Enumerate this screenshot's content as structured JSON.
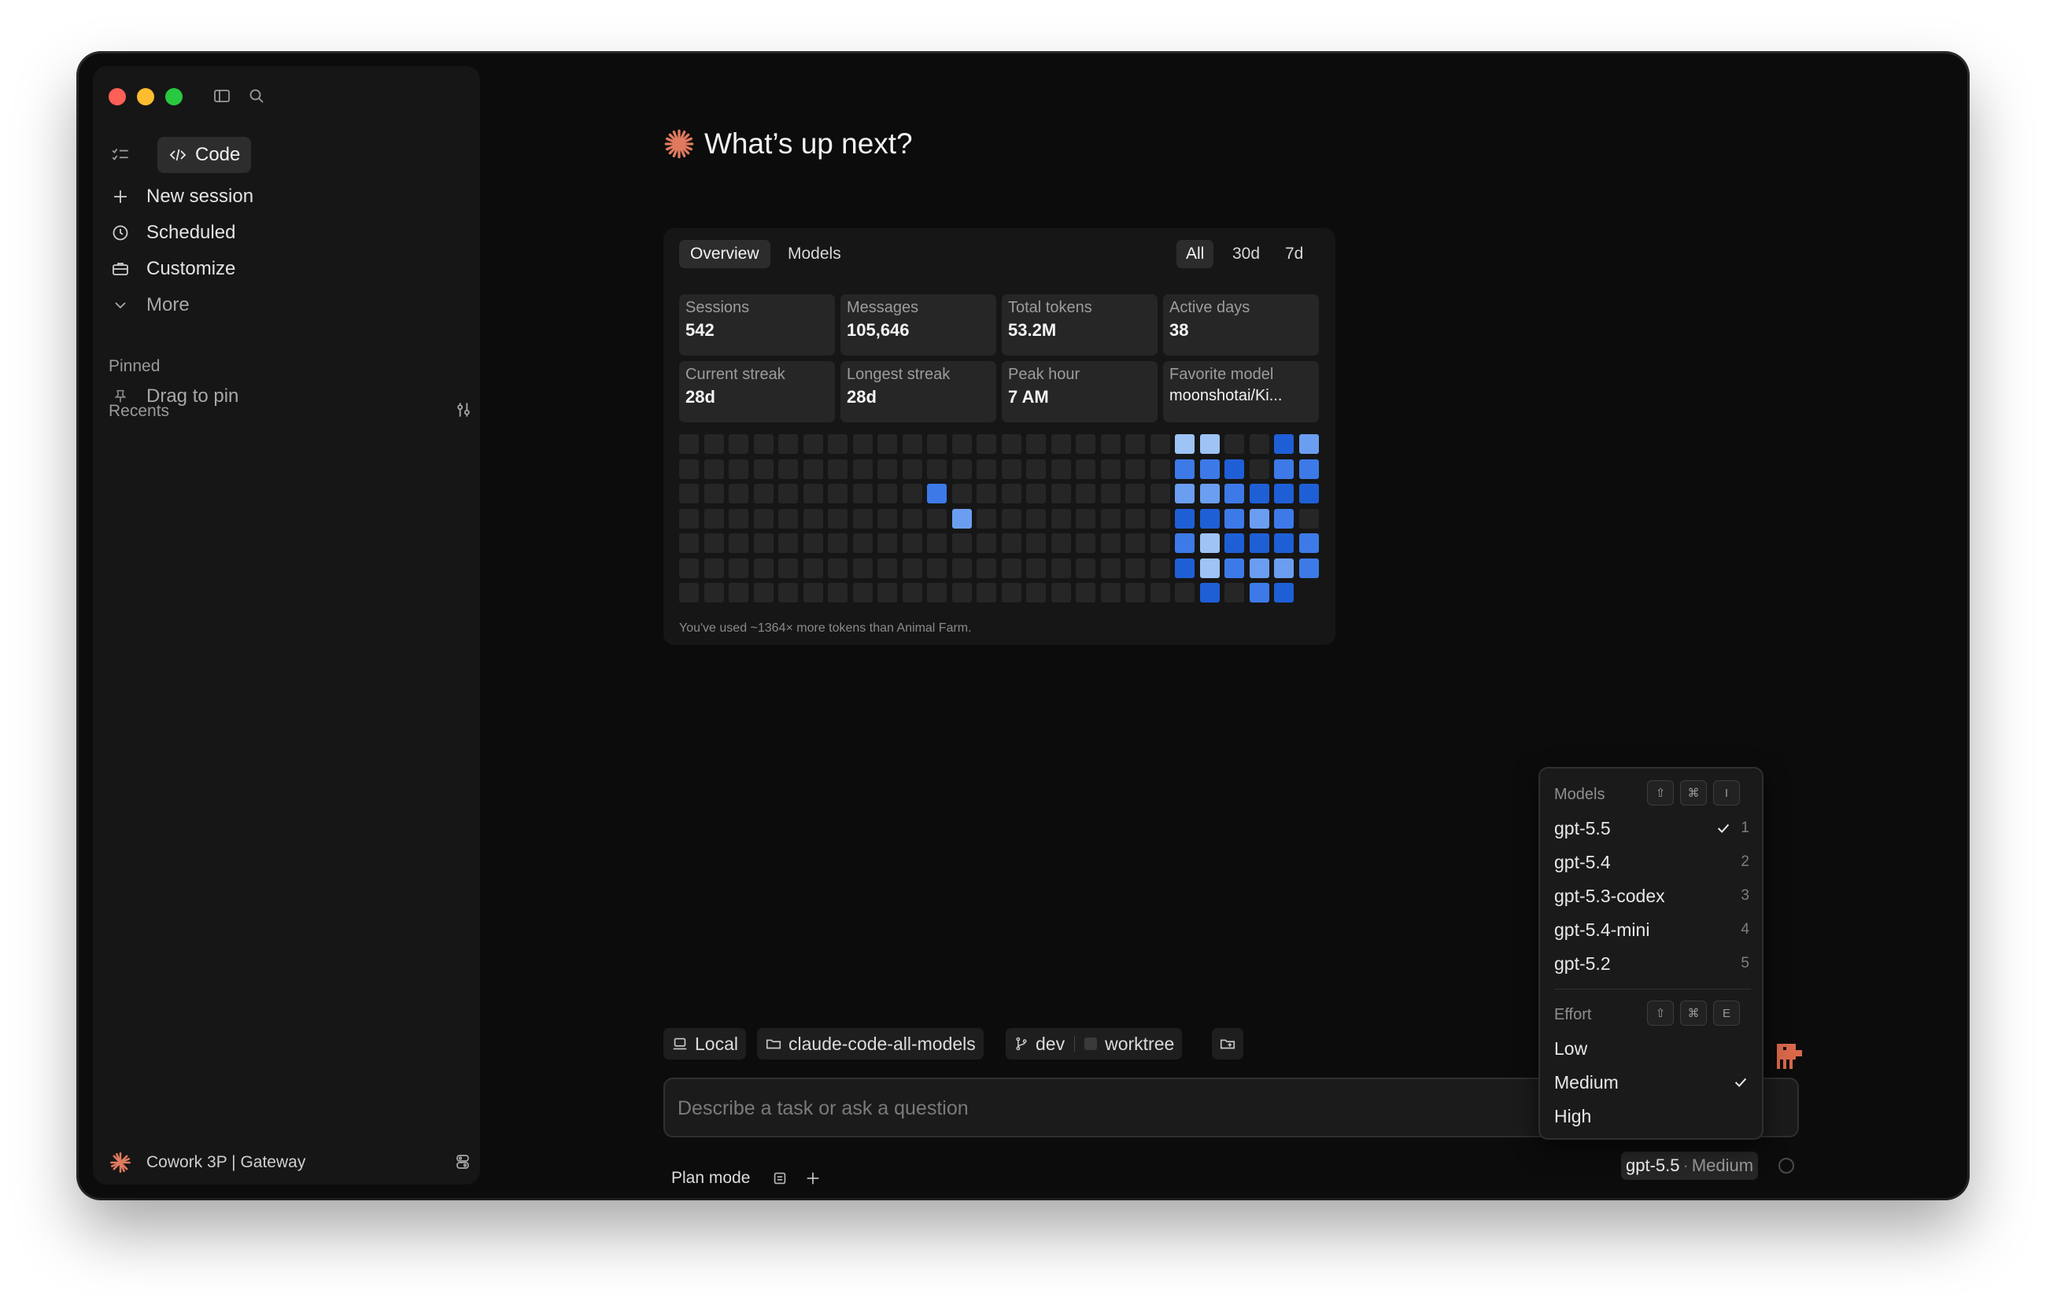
{
  "sidebar": {
    "code_label": "Code",
    "nav": [
      {
        "label": "New session",
        "icon": "plus-icon"
      },
      {
        "label": "Scheduled",
        "icon": "clock-icon"
      },
      {
        "label": "Customize",
        "icon": "briefcase-icon"
      },
      {
        "label": "More",
        "icon": "chevron-down-icon"
      }
    ],
    "pinned_label": "Pinned",
    "drag_to_pin": "Drag to pin",
    "recents_label": "Recents",
    "footer_label": "Cowork 3P | Gateway"
  },
  "main": {
    "headline": "What’s up next?",
    "stats": {
      "tabs": [
        "Overview",
        "Models"
      ],
      "ranges": [
        "All",
        "30d",
        "7d"
      ],
      "cards": [
        {
          "label": "Sessions",
          "value": "542"
        },
        {
          "label": "Messages",
          "value": "105,646"
        },
        {
          "label": "Total tokens",
          "value": "53.2M"
        },
        {
          "label": "Active days",
          "value": "38"
        },
        {
          "label": "Current streak",
          "value": "28d"
        },
        {
          "label": "Longest streak",
          "value": "28d"
        },
        {
          "label": "Peak hour",
          "value": "7 AM"
        },
        {
          "label": "Favorite model",
          "value": "moonshotai/Ki..."
        }
      ],
      "footnote": "You've used ~1364× more tokens than Animal Farm."
    },
    "context_chips": [
      {
        "label": "Local",
        "icon": "laptop-icon"
      },
      {
        "label": "claude-code-all-models",
        "icon": "folder-icon"
      },
      {
        "label": "dev",
        "icon": "git-branch-icon"
      },
      {
        "label": "worktree",
        "icon": "worktree-toggle-icon"
      }
    ],
    "input_placeholder": "Describe a task or ask a question",
    "plan_mode": "Plan mode",
    "model_badge": {
      "model": "gpt-5.5",
      "separator": "·",
      "effort": "Medium"
    }
  },
  "dropdown": {
    "models_header": "Models",
    "models_shortcut": [
      "⇧",
      "⌘",
      "I"
    ],
    "models": [
      {
        "name": "gpt-5.5",
        "num": "1",
        "selected": true
      },
      {
        "name": "gpt-5.4",
        "num": "2",
        "selected": false
      },
      {
        "name": "gpt-5.3-codex",
        "num": "3",
        "selected": false
      },
      {
        "name": "gpt-5.4-mini",
        "num": "4",
        "selected": false
      },
      {
        "name": "gpt-5.2",
        "num": "5",
        "selected": false
      }
    ],
    "effort_header": "Effort",
    "effort_shortcut": [
      "⇧",
      "⌘",
      "E"
    ],
    "efforts": [
      {
        "name": "Low",
        "selected": false
      },
      {
        "name": "Medium",
        "selected": true
      },
      {
        "name": "High",
        "selected": false
      }
    ]
  },
  "heatmap": {
    "columns": 26,
    "rows": 7,
    "colors": {
      "empty": "#262626",
      "level1": "#9ec3f5",
      "level2": "#6b9ef0",
      "level3": "#3d7ae8",
      "level4": "#1f5fd6"
    },
    "active_levels": [
      [
        10,
        2,
        2
      ],
      [
        11,
        3,
        1
      ],
      [
        20,
        0,
        0
      ],
      [
        20,
        1,
        2
      ],
      [
        20,
        2,
        1
      ],
      [
        20,
        3,
        3
      ],
      [
        20,
        4,
        2
      ],
      [
        20,
        5,
        3
      ],
      [
        21,
        0,
        0
      ],
      [
        21,
        1,
        2
      ],
      [
        21,
        2,
        1
      ],
      [
        21,
        3,
        3
      ],
      [
        21,
        4,
        0
      ],
      [
        21,
        5,
        0
      ],
      [
        21,
        6,
        3
      ],
      [
        22,
        0,
        4
      ],
      [
        22,
        1,
        3
      ],
      [
        22,
        2,
        2
      ],
      [
        22,
        3,
        2
      ],
      [
        22,
        4,
        3
      ],
      [
        22,
        5,
        2
      ],
      [
        22,
        6,
        4
      ],
      [
        23,
        0,
        4
      ],
      [
        23,
        1,
        4
      ],
      [
        23,
        2,
        3
      ],
      [
        23,
        3,
        1
      ],
      [
        23,
        4,
        3
      ],
      [
        23,
        5,
        1
      ],
      [
        23,
        6,
        2
      ],
      [
        24,
        0,
        3
      ],
      [
        24,
        1,
        2
      ],
      [
        24,
        2,
        3
      ],
      [
        24,
        3,
        2
      ],
      [
        24,
        4,
        3
      ],
      [
        24,
        5,
        1
      ],
      [
        24,
        6,
        3
      ],
      [
        25,
        0,
        1
      ],
      [
        25,
        1,
        2
      ],
      [
        25,
        2,
        3
      ],
      [
        25,
        3,
        4
      ],
      [
        25,
        4,
        2
      ],
      [
        25,
        5,
        2
      ]
    ]
  }
}
